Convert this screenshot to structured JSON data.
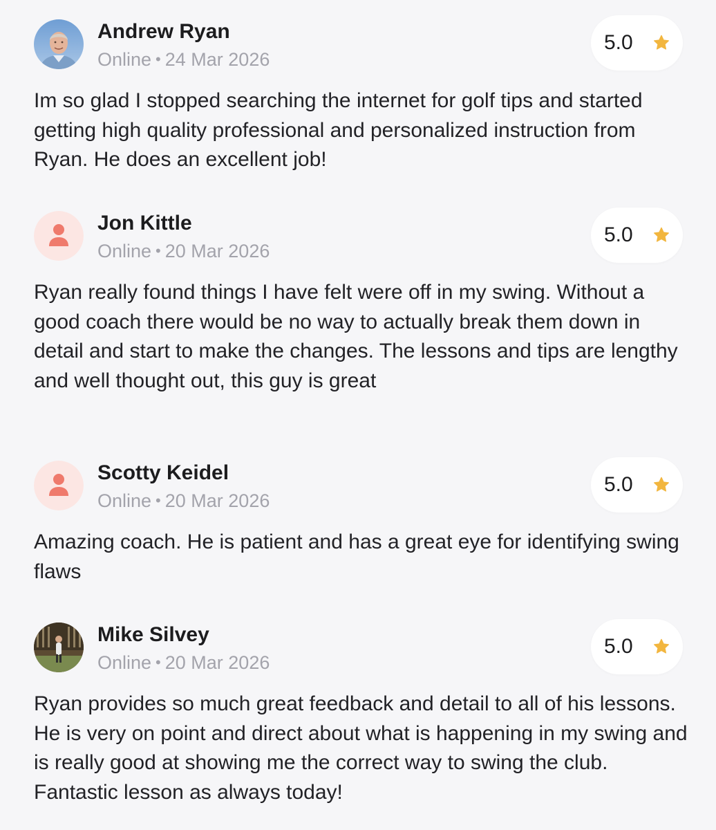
{
  "reviews": [
    {
      "name": "Andrew Ryan",
      "status": "Online",
      "separator": "•",
      "date": "24 Mar 2026",
      "rating": "5.0",
      "text": "Im so glad I stopped searching the internet for golf tips and started getting high quality professional and personalized instruction from Ryan. He does an excellent job!",
      "avatar": "photo"
    },
    {
      "name": "Jon Kittle",
      "status": "Online",
      "separator": "•",
      "date": "20 Mar 2026",
      "rating": "5.0",
      "text": "Ryan really found things I have felt were off in my swing. Without a good coach there would be no way to actually break them down in detail and start to make the changes. The lessons and tips are lengthy and well thought out, this guy is great",
      "avatar": "person-icon"
    },
    {
      "name": "Scotty Keidel",
      "status": "Online",
      "separator": "•",
      "date": "20 Mar 2026",
      "rating": "5.0",
      "text": "Amazing coach. He is patient and has a great eye for identifying swing flaws",
      "avatar": "person-icon"
    },
    {
      "name": "Mike Silvey",
      "status": "Online",
      "separator": "•",
      "date": "20 Mar 2026",
      "rating": "5.0",
      "text": "Ryan provides so much great feedback and detail to all of his lessons. He is very on point and direct about what is happening in my swing and is really good at showing me the correct way to swing the club. Fantastic lesson as always today!",
      "avatar": "photo"
    }
  ],
  "colors": {
    "background": "#f6f6f8",
    "star": "#f2b63f",
    "placeholder_avatar_bg": "#fce6e3",
    "placeholder_avatar_icon": "#ef7a6c",
    "meta_text": "#a3a3ab"
  }
}
